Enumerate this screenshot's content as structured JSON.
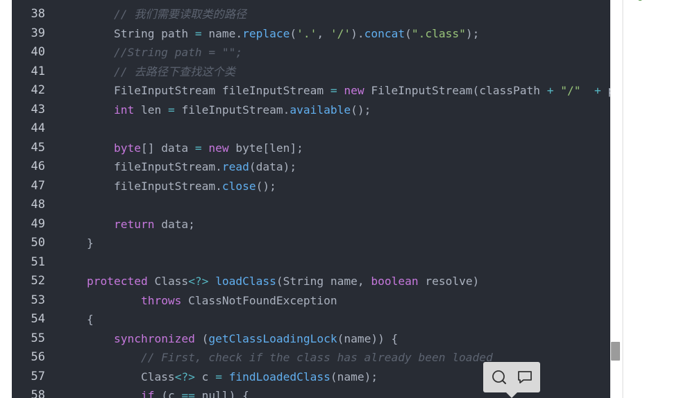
{
  "editor": {
    "theme_colors": {
      "background": "#282c34",
      "text": "#abb2bf",
      "keyword": "#c678dd",
      "function": "#61afef",
      "string": "#98c379",
      "operator": "#56b6c2",
      "comment": "#5c6370",
      "line_number": "#c5cad3"
    },
    "lines": [
      {
        "n": "38",
        "tokens": [
          [
            "cm",
            "        // 我们需要读取类的路径"
          ]
        ]
      },
      {
        "n": "39",
        "tokens": [
          [
            "t",
            "        String path "
          ],
          [
            "op",
            "="
          ],
          [
            "t",
            " name."
          ],
          [
            "fn",
            "replace"
          ],
          [
            "t",
            "("
          ],
          [
            "str",
            "'.'"
          ],
          [
            "t",
            ", "
          ],
          [
            "str",
            "'/'"
          ],
          [
            "t",
            ")."
          ],
          [
            "fn",
            "concat"
          ],
          [
            "t",
            "("
          ],
          [
            "str",
            "\".class\""
          ],
          [
            "t",
            ");"
          ]
        ]
      },
      {
        "n": "40",
        "tokens": [
          [
            "cm",
            "        //String path = \"\";"
          ]
        ]
      },
      {
        "n": "41",
        "tokens": [
          [
            "cm",
            "        // 去路径下查找这个类"
          ]
        ]
      },
      {
        "n": "42",
        "tokens": [
          [
            "t",
            "        FileInputStream fileInputStream "
          ],
          [
            "op",
            "="
          ],
          [
            "t",
            " "
          ],
          [
            "kw",
            "new"
          ],
          [
            "t",
            " FileInputStream(classPath "
          ],
          [
            "op",
            "+"
          ],
          [
            "t",
            " "
          ],
          [
            "str",
            "\"/\""
          ],
          [
            "t",
            "  "
          ],
          [
            "op",
            "+"
          ],
          [
            "t",
            " pa"
          ]
        ]
      },
      {
        "n": "43",
        "tokens": [
          [
            "t",
            "        "
          ],
          [
            "kw",
            "int"
          ],
          [
            "t",
            " len "
          ],
          [
            "op",
            "="
          ],
          [
            "t",
            " fileInputStream."
          ],
          [
            "fn",
            "available"
          ],
          [
            "t",
            "();"
          ]
        ]
      },
      {
        "n": "44",
        "tokens": []
      },
      {
        "n": "45",
        "tokens": [
          [
            "t",
            "        "
          ],
          [
            "kw",
            "byte"
          ],
          [
            "t",
            "[] data "
          ],
          [
            "op",
            "="
          ],
          [
            "t",
            " "
          ],
          [
            "kw",
            "new"
          ],
          [
            "t",
            " byte[len];"
          ]
        ]
      },
      {
        "n": "46",
        "tokens": [
          [
            "t",
            "        fileInputStream."
          ],
          [
            "fn",
            "read"
          ],
          [
            "t",
            "(data);"
          ]
        ]
      },
      {
        "n": "47",
        "tokens": [
          [
            "t",
            "        fileInputStream."
          ],
          [
            "fn",
            "close"
          ],
          [
            "t",
            "();"
          ]
        ]
      },
      {
        "n": "48",
        "tokens": []
      },
      {
        "n": "49",
        "tokens": [
          [
            "t",
            "        "
          ],
          [
            "kw",
            "return"
          ],
          [
            "t",
            " data;"
          ]
        ]
      },
      {
        "n": "50",
        "tokens": [
          [
            "t",
            "    }"
          ]
        ]
      },
      {
        "n": "51",
        "tokens": []
      },
      {
        "n": "52",
        "tokens": [
          [
            "t",
            "    "
          ],
          [
            "kw",
            "protected"
          ],
          [
            "t",
            " Class"
          ],
          [
            "op",
            "<?>"
          ],
          [
            "t",
            " "
          ],
          [
            "fn",
            "loadClass"
          ],
          [
            "t",
            "(String name, "
          ],
          [
            "kw",
            "boolean"
          ],
          [
            "t",
            " resolve)"
          ]
        ]
      },
      {
        "n": "53",
        "tokens": [
          [
            "t",
            "            "
          ],
          [
            "kw",
            "throws"
          ],
          [
            "t",
            " ClassNotFoundException"
          ]
        ]
      },
      {
        "n": "54",
        "tokens": [
          [
            "t",
            "    {"
          ]
        ]
      },
      {
        "n": "55",
        "tokens": [
          [
            "t",
            "        "
          ],
          [
            "kw",
            "synchronized"
          ],
          [
            "t",
            " ("
          ],
          [
            "fn",
            "getClassLoadingLock"
          ],
          [
            "t",
            "(name)) {"
          ]
        ]
      },
      {
        "n": "56",
        "tokens": [
          [
            "cm",
            "            // First, check if the class has already been loaded"
          ]
        ]
      },
      {
        "n": "57",
        "tokens": [
          [
            "t",
            "            Class"
          ],
          [
            "op",
            "<?>"
          ],
          [
            "t",
            " c "
          ],
          [
            "op",
            "="
          ],
          [
            "t",
            " "
          ],
          [
            "fn",
            "findLoadedClass"
          ],
          [
            "t",
            "(name);"
          ]
        ]
      },
      {
        "n": "58",
        "tokens": [
          [
            "t",
            "            "
          ],
          [
            "kw",
            "if"
          ],
          [
            "t",
            " (c "
          ],
          [
            "op",
            "=="
          ],
          [
            "t",
            " null) {"
          ]
        ]
      }
    ]
  },
  "floating_toolbar": {
    "search_icon": "search-icon",
    "comment_icon": "comment-icon"
  }
}
